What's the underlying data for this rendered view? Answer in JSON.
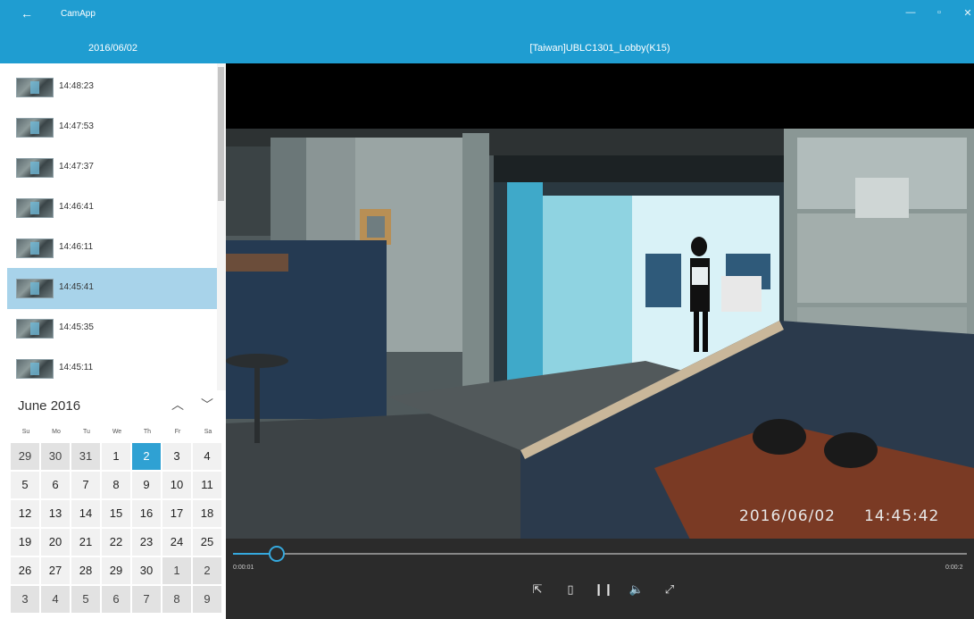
{
  "titlebar": {
    "back_icon": "back-arrow-icon",
    "app_title": "CamApp",
    "minimize_glyph": "—",
    "maximize_glyph": "▫",
    "close_glyph": "✕"
  },
  "header": {
    "date": "2016/06/02",
    "camera": "[Taiwan]UBLC1301_Lobby(K15)"
  },
  "clips": [
    {
      "time": "14:48:23",
      "selected": false
    },
    {
      "time": "14:47:53",
      "selected": false
    },
    {
      "time": "14:47:37",
      "selected": false
    },
    {
      "time": "14:46:41",
      "selected": false
    },
    {
      "time": "14:46:11",
      "selected": false
    },
    {
      "time": "14:45:41",
      "selected": true
    },
    {
      "time": "14:45:35",
      "selected": false
    },
    {
      "time": "14:45:11",
      "selected": false
    }
  ],
  "calendar": {
    "month_label": "June 2016",
    "prev_glyph": "︿",
    "next_glyph": "﹀",
    "weekdays": [
      "Su",
      "Mo",
      "Tu",
      "We",
      "Th",
      "Fr",
      "Sa"
    ],
    "weeks": [
      [
        "29",
        "30",
        "31",
        "1",
        "2",
        "3",
        "4"
      ],
      [
        "5",
        "6",
        "7",
        "8",
        "9",
        "10",
        "11"
      ],
      [
        "12",
        "13",
        "14",
        "15",
        "16",
        "17",
        "18"
      ],
      [
        "19",
        "20",
        "21",
        "22",
        "23",
        "24",
        "25"
      ],
      [
        "26",
        "27",
        "28",
        "29",
        "30",
        "1",
        "2"
      ],
      [
        "3",
        "4",
        "5",
        "6",
        "7",
        "8",
        "9"
      ]
    ],
    "selected_day": "2"
  },
  "video": {
    "overlay_date": "2016/06/02",
    "overlay_time": "14:45:42"
  },
  "player": {
    "current_time": "0:00:01",
    "end_time": "0:00:2",
    "progress": 0.06,
    "buttons": [
      {
        "name": "share-icon",
        "glyph": "⇱"
      },
      {
        "name": "frame-icon",
        "glyph": "▯"
      },
      {
        "name": "pause-icon",
        "glyph": "❙❙"
      },
      {
        "name": "volume-icon",
        "glyph": "🔈"
      },
      {
        "name": "fullscreen-icon",
        "glyph": "⤢"
      }
    ]
  },
  "colors": {
    "accent": "#1f9dd1",
    "selected_row": "#a8d3ea",
    "today": "#2fa1d3",
    "seek": "#35a9de"
  }
}
